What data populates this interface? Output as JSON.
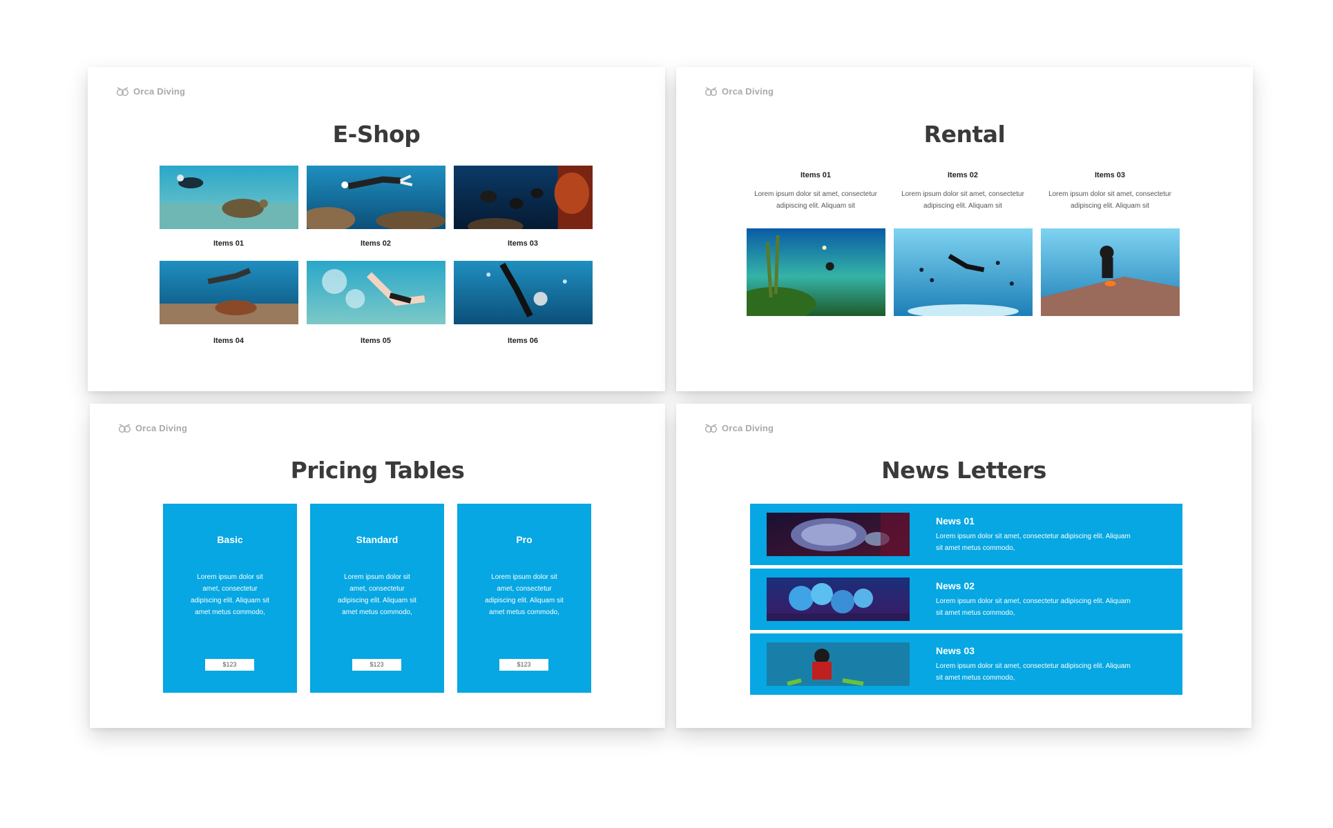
{
  "brand": {
    "name": "Orca Diving"
  },
  "colors": {
    "accent": "#06a7e2",
    "title": "#3a3a3a",
    "brand_gray": "#a9a9a9",
    "canvas": "#ffffff"
  },
  "eshop": {
    "title": "E-Shop",
    "items": [
      {
        "label": "Items 01",
        "image": "diver-with-sea-turtle"
      },
      {
        "label": "Items 02",
        "image": "diver-over-coral-and-turtle"
      },
      {
        "label": "Items 03",
        "image": "divers-by-coral-reef"
      },
      {
        "label": "Items 04",
        "image": "snorkeler-with-turtle"
      },
      {
        "label": "Items 05",
        "image": "diver-in-bubbles"
      },
      {
        "label": "Items 06",
        "image": "freediver-descending"
      }
    ]
  },
  "rental": {
    "title": "Rental",
    "items": [
      {
        "label": "Items 01",
        "line1": "Lorem ipsum dolor sit amet, consectetur",
        "line2": "adipiscing elit. Aliquam sit",
        "image": "diver-with-torch-over-reef"
      },
      {
        "label": "Items 02",
        "line1": "Lorem ipsum dolor sit amet, consectetur",
        "line2": "adipiscing elit. Aliquam sit",
        "image": "diver-among-fish"
      },
      {
        "label": "Items 03",
        "line1": "Lorem ipsum dolor sit amet, consectetur",
        "line2": "adipiscing elit. Aliquam sit",
        "image": "diver-with-clownfish"
      }
    ]
  },
  "pricing": {
    "title": "Pricing Tables",
    "plans": [
      {
        "name": "Basic",
        "lines": [
          "Lorem ipsum dolor sit",
          "amet, consectetur",
          "adipiscing elit. Aliquam sit",
          "amet metus commodo,"
        ],
        "price": "$123"
      },
      {
        "name": "Standard",
        "lines": [
          "Lorem ipsum dolor sit",
          "amet, consectetur",
          "adipiscing elit. Aliquam sit",
          "amet metus commodo,"
        ],
        "price": "$123"
      },
      {
        "name": "Pro",
        "lines": [
          "Lorem ipsum dolor sit",
          "amet, consectetur",
          "adipiscing elit. Aliquam sit",
          "amet metus commodo,"
        ],
        "price": "$123"
      }
    ]
  },
  "news": {
    "title": "News Letters",
    "items": [
      {
        "title": "News 01",
        "line1": "Lorem ipsum dolor sit amet, consectetur adipiscing elit. Aliquam",
        "line2": "sit amet metus commodo,",
        "image": "sea-turtle-closeup"
      },
      {
        "title": "News 02",
        "line1": "Lorem ipsum dolor sit amet, consectetur adipiscing elit. Aliquam",
        "line2": "sit amet metus commodo,",
        "image": "blue-coral"
      },
      {
        "title": "News 03",
        "line1": "Lorem ipsum dolor sit amet, consectetur adipiscing elit. Aliquam",
        "line2": "sit amet metus commodo,",
        "image": "diver-with-fins"
      }
    ]
  }
}
